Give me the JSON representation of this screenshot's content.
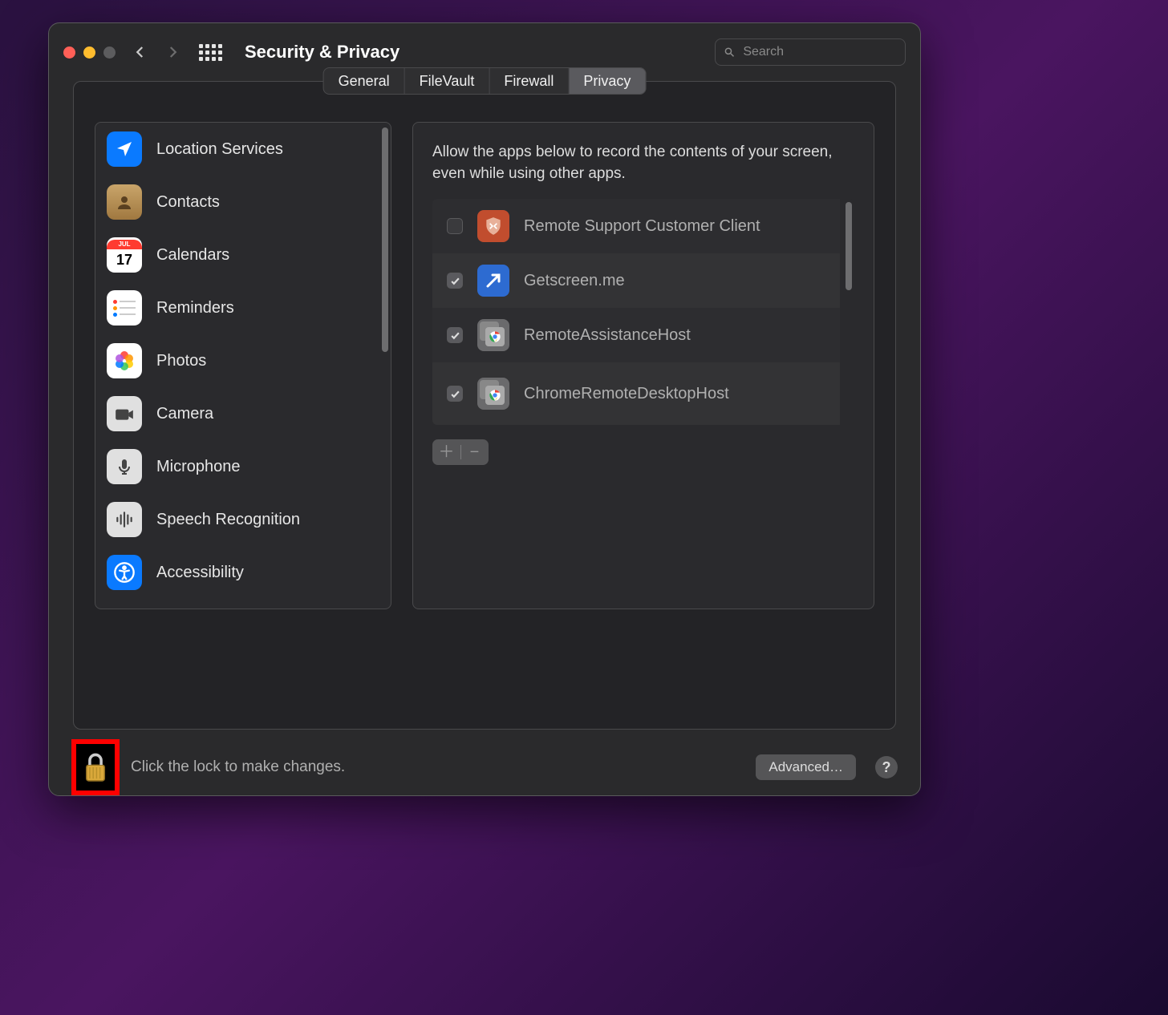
{
  "header": {
    "title": "Security & Privacy",
    "search_placeholder": "Search"
  },
  "tabs": [
    {
      "label": "General"
    },
    {
      "label": "FileVault"
    },
    {
      "label": "Firewall"
    },
    {
      "label": "Privacy",
      "active": true
    }
  ],
  "sidebar": [
    {
      "label": "Location Services",
      "icon": "location",
      "color": "#0a7aff"
    },
    {
      "label": "Contacts",
      "icon": "contacts",
      "color": "#b38f5a"
    },
    {
      "label": "Calendars",
      "icon": "calendar",
      "color": "#ffffff"
    },
    {
      "label": "Reminders",
      "icon": "reminders",
      "color": "#ffffff"
    },
    {
      "label": "Photos",
      "icon": "photos",
      "color": "#ffffff"
    },
    {
      "label": "Camera",
      "icon": "camera",
      "color": "#e0e0e0"
    },
    {
      "label": "Microphone",
      "icon": "microphone",
      "color": "#e0e0e0"
    },
    {
      "label": "Speech Recognition",
      "icon": "speech",
      "color": "#e0e0e0"
    },
    {
      "label": "Accessibility",
      "icon": "accessibility",
      "color": "#0a7aff"
    }
  ],
  "detail": {
    "description": "Allow the apps below to record the contents of your screen, even while using other apps.",
    "apps": [
      {
        "name": "Remote Support Customer Client",
        "checked": false,
        "icon": "shield"
      },
      {
        "name": "Getscreen.me",
        "checked": true,
        "icon": "arrow-app"
      },
      {
        "name": "RemoteAssistanceHost",
        "checked": true,
        "icon": "chrome"
      },
      {
        "name": "ChromeRemoteDesktopHost",
        "checked": true,
        "icon": "chrome"
      }
    ]
  },
  "footer": {
    "lock_text": "Click the lock to make changes.",
    "advanced_label": "Advanced…"
  }
}
